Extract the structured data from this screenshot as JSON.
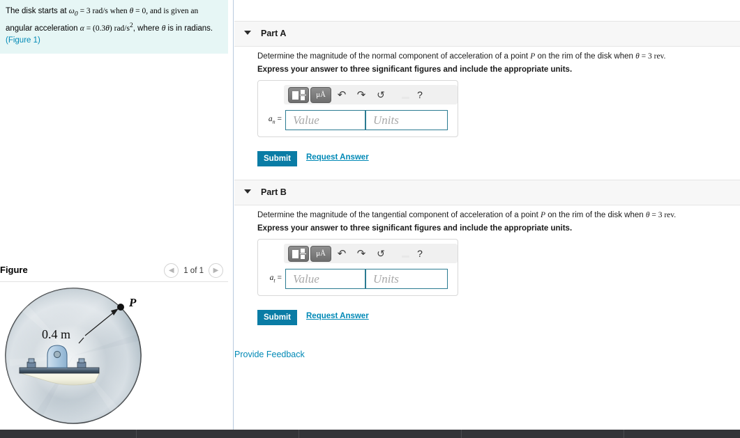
{
  "question": {
    "line1_pre": "The disk starts at ",
    "omega": "ω",
    "omega_sub": "0",
    "line1_mid": " = 3 rad/s when ",
    "theta": "θ",
    "line1_post": " = 0, and is given an",
    "line2_pre": "angular acceleration ",
    "alpha": "α",
    "line2_mid": " = (0.3",
    "line2_units": ") rad/s",
    "line2_exp": "2",
    "line2_post": ", where ",
    "line2_end": " is in radians.",
    "figure_link": "(Figure 1)"
  },
  "figure": {
    "title": "Figure",
    "count": "1 of 1",
    "prev_icon": "chevron-left-icon",
    "next_icon": "chevron-right-icon",
    "radius_label": "0.4 m",
    "point_label": "P"
  },
  "parts": [
    {
      "id": "a",
      "label": "Part A",
      "prompt_pre": "Determine the magnitude of the normal component of acceleration of a point ",
      "prompt_p": "P",
      "prompt_mid": " on the rim of the disk when ",
      "prompt_theta": "θ",
      "prompt_post": " = 3 rev.",
      "instruction": "Express your answer to three significant figures and include the appropriate units.",
      "var_name": "a",
      "var_sub": "n",
      "var_eq": "=",
      "value_placeholder": "Value",
      "units_placeholder": "Units",
      "value": "",
      "units": "",
      "submit_label": "Submit",
      "request_label": "Request Answer",
      "toolbar": {
        "template_icon": "math-template-icon",
        "units_icon": "micro-angstrom-icon",
        "units_icon_label": "μÅ",
        "undo_icon": "undo-arrow-icon",
        "undo_glyph": "↶",
        "redo_icon": "redo-arrow-icon",
        "redo_glyph": "↷",
        "reset_icon": "reset-circular-arrow-icon",
        "reset_glyph": "↺",
        "keyboard_icon": "keyboard-icon",
        "help_icon": "help-question-icon",
        "help_glyph": "?"
      }
    },
    {
      "id": "b",
      "label": "Part B",
      "prompt_pre": "Determine the magnitude of the tangential component of acceleration of a point ",
      "prompt_p": "P",
      "prompt_mid": " on the rim of the disk when ",
      "prompt_theta": "θ",
      "prompt_post": " = 3 rev.",
      "instruction": "Express your answer to three significant figures and include the appropriate units.",
      "var_name": "a",
      "var_sub": "t",
      "var_eq": "=",
      "value_placeholder": "Value",
      "units_placeholder": "Units",
      "value": "",
      "units": "",
      "submit_label": "Submit",
      "request_label": "Request Answer",
      "toolbar": {
        "template_icon": "math-template-icon",
        "units_icon": "micro-angstrom-icon",
        "units_icon_label": "μÅ",
        "undo_icon": "undo-arrow-icon",
        "undo_glyph": "↶",
        "redo_icon": "redo-arrow-icon",
        "redo_glyph": "↷",
        "reset_icon": "reset-circular-arrow-icon",
        "reset_glyph": "↺",
        "keyboard_icon": "keyboard-icon",
        "help_icon": "help-question-icon",
        "help_glyph": "?"
      }
    }
  ],
  "footer": {
    "feedback_label": "Provide Feedback"
  },
  "colors": {
    "question_bg": "#e6f6f5",
    "link": "#0089b6",
    "submit_bg": "#0a7ca5",
    "part_header_bg": "#f7f7f7",
    "input_border": "#2b7b92",
    "bottom_bar": "#333438"
  }
}
